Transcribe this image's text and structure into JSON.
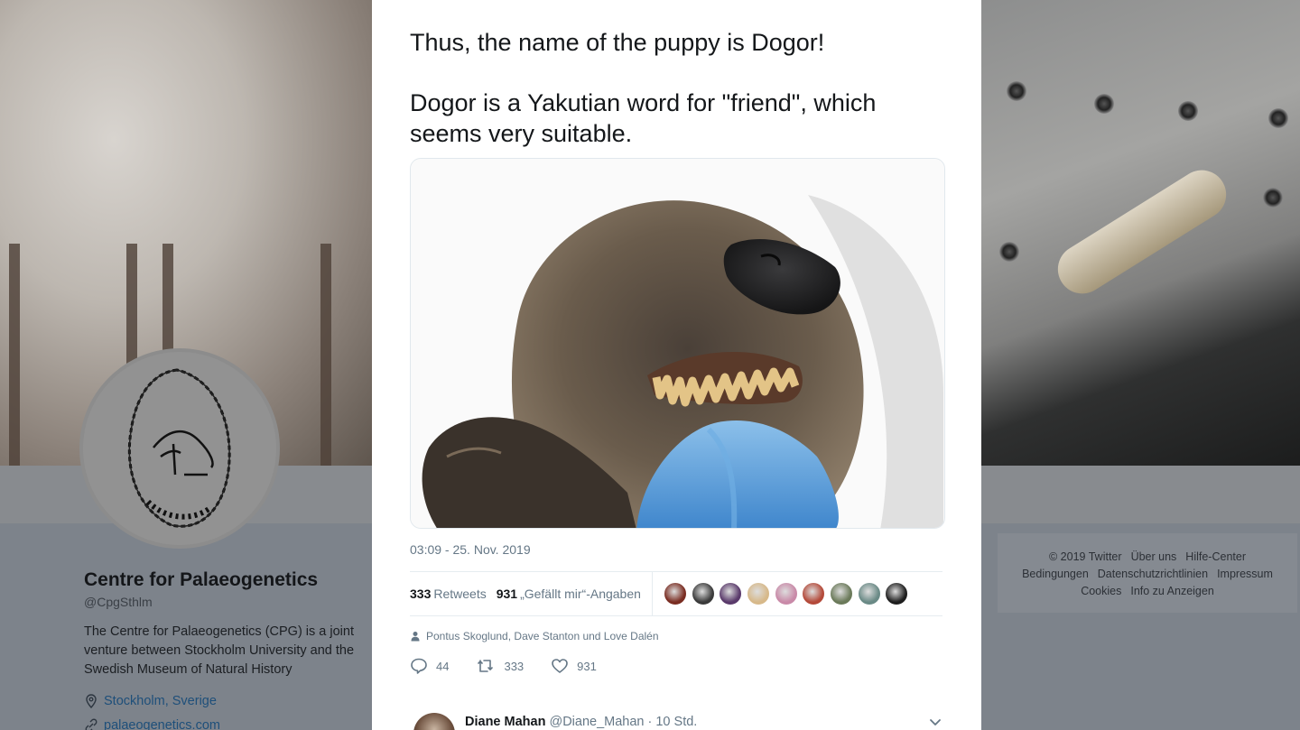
{
  "profile": {
    "name": "Centre for Palaeogenetics",
    "handle": "@CpgSthlm",
    "bio": "The Centre for Palaeogenetics (CPG) is a joint venture between Stockholm University and the Swedish Museum of Natural History",
    "location": "Stockholm, Sverige",
    "website": "palaeogenetics.com"
  },
  "footer": {
    "links": [
      "© 2019 Twitter",
      "Über uns",
      "Hilfe-Center",
      "Bedingungen",
      "Datenschutzrichtlinien",
      "Impressum",
      "Cookies",
      "Info zu Anzeigen"
    ]
  },
  "tweet": {
    "paragraph_1": "Thus, the name of the puppy is Dogor!",
    "paragraph_2": "Dogor is a Yakutian word for \"friend\", which seems very suitable.",
    "timestamp": "03:09 - 25. Nov. 2019",
    "retweets_count": "333",
    "retweets_label": "Retweets",
    "likes_count": "931",
    "likes_label": "„Gefällt mir“-Angaben",
    "liker_colors": [
      "#7a2d22",
      "#3b3b3b",
      "#5a3a6b",
      "#d7b98a",
      "#c98aa8",
      "#b44a3a",
      "#6b7a5a",
      "#6a8a86",
      "#1e1e1e"
    ],
    "tagged": "Pontus Skoglund, Dave Stanton und Love Dalén",
    "reply_count": "44",
    "retweet_count": "333",
    "like_count": "931"
  },
  "reply": {
    "name": "Diane Mahan",
    "handle_time": "@Diane_Mahan · 10 Std."
  }
}
